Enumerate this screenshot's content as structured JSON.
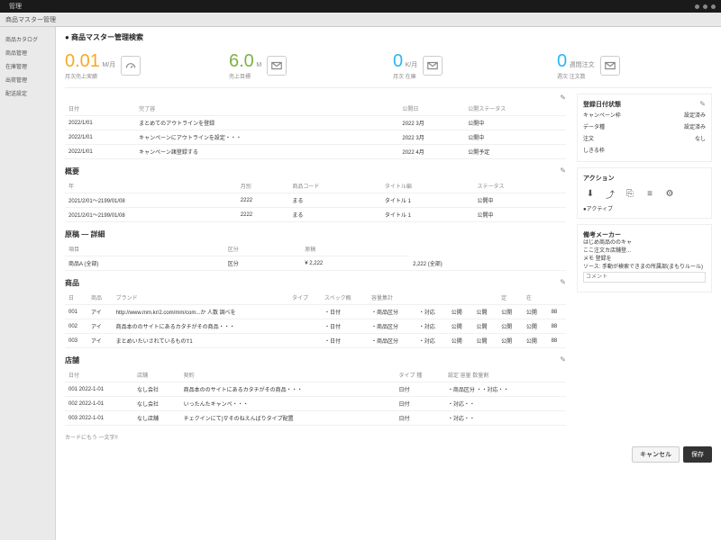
{
  "titlebar": {
    "app": "管理"
  },
  "tabbar": {
    "text": "商品マスター管理"
  },
  "sidebar": {
    "items": [
      {
        "label": "商品カタログ"
      },
      {
        "label": "商品管理"
      },
      {
        "label": "在庫管理"
      },
      {
        "label": "出荷管理"
      },
      {
        "label": "配送設定"
      }
    ]
  },
  "crumb": "● 商品マスター管理検索",
  "metrics": [
    {
      "value": "0.01",
      "unit": "M/月",
      "sub": "月次売上実績"
    },
    {
      "value": "6.0",
      "unit": "M",
      "sub": "売上目標"
    },
    {
      "value": "0",
      "unit": "K/月",
      "sub": "月次 在庫"
    },
    {
      "value": "0",
      "unit": "週間注文",
      "sub": "週次 注文数"
    }
  ],
  "table1": {
    "title": "",
    "headers": [
      "日付",
      "完了容",
      "",
      "公開日",
      "公開ステータス"
    ],
    "rows": [
      [
        "2022/1/01",
        "まとめてのアウトラインを登録",
        "",
        "2022 3月",
        "公開中"
      ],
      [
        "2022/1/01",
        "キャンペーンにアウトラインを設定・・・",
        "",
        "2022 3月",
        "公開中"
      ],
      [
        "2022/1/01",
        "キャンペーン諸登録する",
        "",
        "2022 4月",
        "公開予定"
      ]
    ]
  },
  "table2": {
    "title": "概要",
    "headers": [
      "年",
      "月別",
      "商品コード",
      "タイトル編",
      "ステータス"
    ],
    "rows": [
      [
        "2021/2/01～2199/01/08",
        "2222",
        "まる",
        "タイトル 1",
        "公開中"
      ],
      [
        "2021/2/01～2199/01/08",
        "2222",
        "まる",
        "タイトル 1",
        "公開中"
      ]
    ]
  },
  "table3": {
    "title": "原稿 — 詳細",
    "headers": [
      "項目",
      "区分",
      "原稿"
    ],
    "rows": [
      [
        "商品A (全部)",
        "区分",
        "¥ 2,222",
        "2,222 (全部)"
      ]
    ]
  },
  "table4": {
    "title": "商品",
    "headers": [
      "日",
      "商品",
      "ブランド",
      "タイプ",
      "スペック概",
      "容量集計",
      "",
      "",
      "",
      "定",
      "在",
      ""
    ],
    "rows": [
      [
        "001",
        "アイ",
        "http://www.mm.kr/2.com/mm/com...か 人数 調べを",
        "",
        "・日付",
        "・商品区分",
        "・対応",
        "公開",
        "公開",
        "公開",
        "公開",
        "88"
      ],
      [
        "002",
        "アイ",
        "商品本ののサイトにあるカタチがその商品・・・",
        "",
        "・日付",
        "・商品区分",
        "・対応",
        "公開",
        "公開",
        "公開",
        "公開",
        "88"
      ],
      [
        "003",
        "アイ",
        "まとめいたいされているもの't'1",
        "",
        "・日付",
        "・商品区分",
        "・対応",
        "公開",
        "公開",
        "公開",
        "公開",
        "88"
      ]
    ]
  },
  "table5": {
    "title": "店舗",
    "headers": [
      "日付",
      "店舗",
      "契約",
      "",
      "タイプ 種",
      "設定 容量 数量割",
      ""
    ],
    "rows": [
      [
        "001 2022-1-01",
        "なし会社",
        "商品本ののサイトにあるカタチがその商品・・・",
        "",
        "日付",
        "・商品区分 ・・対応・・",
        ""
      ],
      [
        "002 2022-1-01",
        "なし会社",
        "いったんたキャンペ・・・",
        "",
        "日付",
        "・対応・・",
        ""
      ],
      [
        "003 2022-1-01",
        "なし店舗",
        "チェクインにて)∇そのねえんばりタイプ配置",
        "",
        "日付",
        "・対応・・",
        ""
      ]
    ]
  },
  "summary_line": "カードにもう    一文字!!",
  "right": {
    "panel1_title": "登録日付状態",
    "panel1_rows": [
      [
        "キャンペーン枠",
        "設定済み"
      ],
      [
        "データ種",
        "設定済み"
      ],
      [
        "注文",
        "なし"
      ],
      [
        "しきる枠",
        ""
      ]
    ],
    "panel2_title": "アクション",
    "panel2_sub": "●アクティブ",
    "panel3_title": "備考メーカー",
    "panel3_lines": [
      "はじめ商品ののキャ",
      "ここ注文カ店舗登...",
      "メモ 登録を",
      "ソース: 手動が検索できまの所属部(まもりルール)"
    ],
    "input_placeholder": "コメント"
  },
  "footer": {
    "cancel": "キャンセル",
    "save": "保存"
  }
}
